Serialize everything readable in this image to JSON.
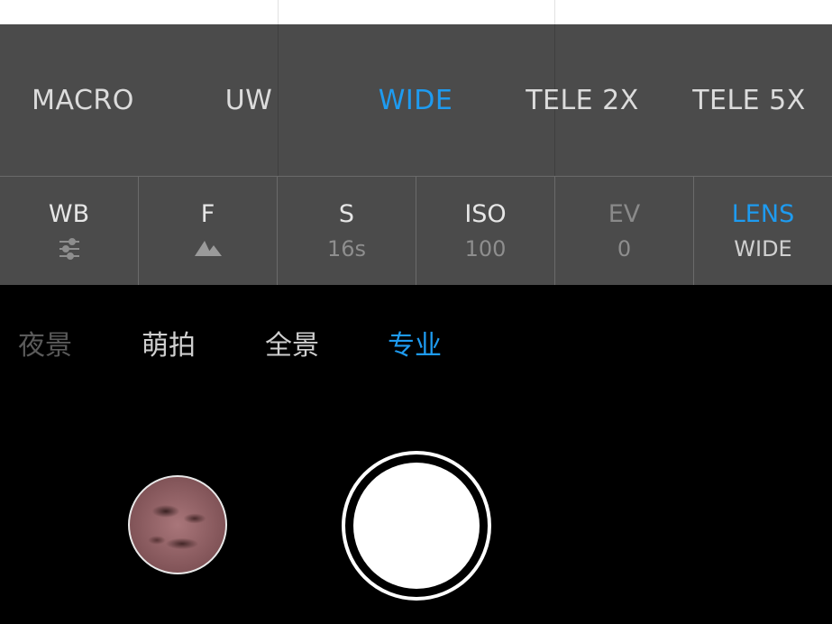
{
  "lenses": {
    "macro": "MACRO",
    "uw": "UW",
    "wide": "WIDE",
    "tele2x": "TELE 2X",
    "tele5x": "TELE 5X",
    "selected": "WIDE"
  },
  "settings": {
    "wb": {
      "label": "WB",
      "icon": "sliders-icon"
    },
    "f": {
      "label": "F",
      "icon": "mountain-icon"
    },
    "s": {
      "label": "S",
      "value": "16s"
    },
    "iso": {
      "label": "ISO",
      "value": "100"
    },
    "ev": {
      "label": "EV",
      "value": "0"
    },
    "lens": {
      "label": "LENS",
      "value": "WIDE"
    }
  },
  "modes": {
    "night": "夜景",
    "cute": "萌拍",
    "panorama": "全景",
    "pro": "专业",
    "selected": "专业"
  },
  "colors": {
    "accent": "#1e9bf0",
    "panel": "#4b4b4b",
    "background": "#000000"
  }
}
